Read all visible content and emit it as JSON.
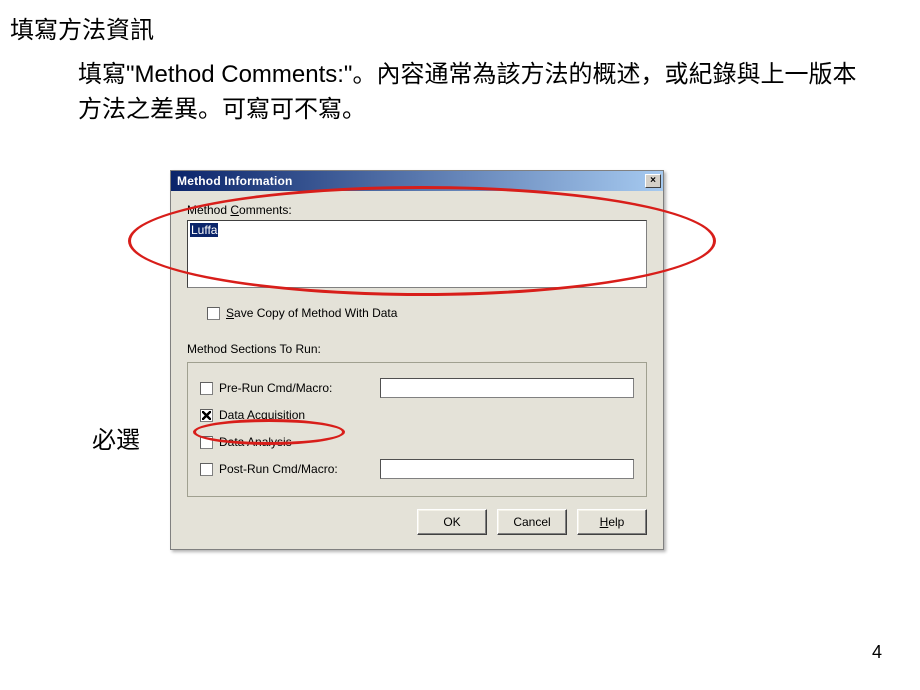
{
  "slide": {
    "title": "填寫方法資訊",
    "body": "填寫\"Method Comments:\"。內容通常為該方法的概述，或紀錄與上一版本方法之差異。可寫可不寫。",
    "annotation": "必選",
    "page_number": "4"
  },
  "dialog": {
    "title": "Method Information",
    "close_glyph": "×",
    "comments_label_pre": "Method ",
    "comments_label_u": "C",
    "comments_label_post": "omments:",
    "comments_value": "Luffa",
    "save_copy_u": "S",
    "save_copy_label": "ave Copy of Method With Data",
    "sections_label": "Method Sections To Run:",
    "pre_run_label": "Pre-Run Cmd/Macro:",
    "data_acq_pre": "Data ",
    "data_acq_u": "A",
    "data_acq_post": "cquisition",
    "data_analysis_label": "Data Analysis",
    "post_run_label": "Post-Run Cmd/Macro:",
    "ok": "OK",
    "cancel": "Cancel",
    "help_u": "H",
    "help_post": "elp"
  }
}
